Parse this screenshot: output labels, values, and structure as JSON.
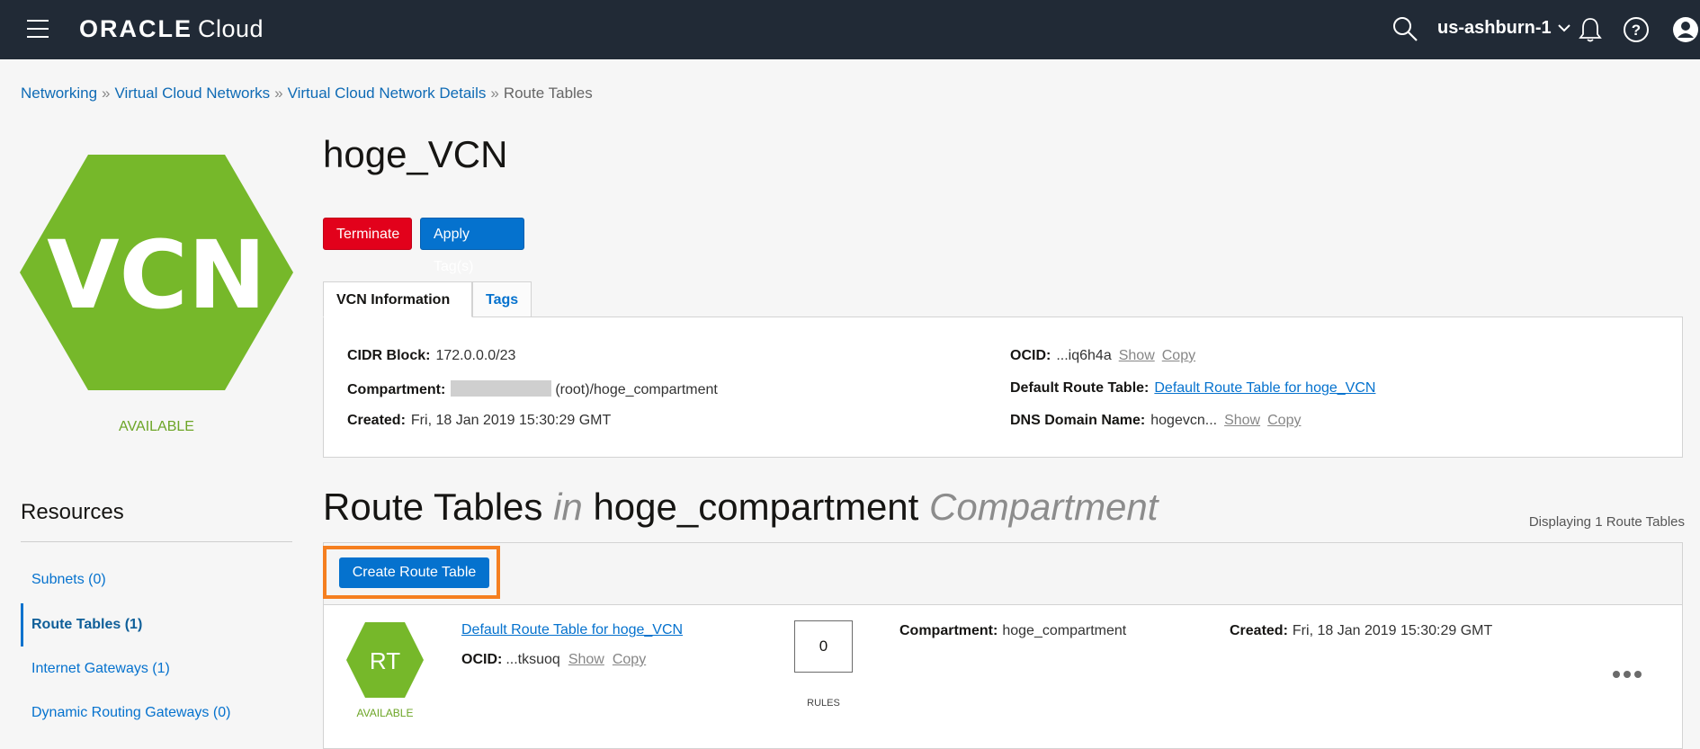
{
  "topbar": {
    "brand_oracle": "ORACLE",
    "brand_cloud": "Cloud",
    "region": "us-ashburn-1",
    "icons": [
      "menu-icon",
      "search-icon",
      "chevron-down-icon",
      "bell-icon",
      "help-icon",
      "user-icon"
    ]
  },
  "breadcrumb": {
    "items": [
      "Networking",
      "Virtual Cloud Networks",
      "Virtual Cloud Network Details"
    ],
    "current": "Route Tables",
    "separator": "»"
  },
  "vcn": {
    "badge": "VCN",
    "status": "AVAILABLE",
    "name": "hoge_VCN",
    "color": "#76b82a"
  },
  "actions": {
    "terminate": "Terminate",
    "apply_tags": "Apply Tag(s)"
  },
  "tabs": {
    "vcn_info": "VCN Information",
    "tags": "Tags"
  },
  "info": {
    "cidr_label": "CIDR Block:",
    "cidr_value": "172.0.0.0/23",
    "compartment_label": "Compartment:",
    "compartment_value": "(root)/hoge_compartment",
    "created_label": "Created:",
    "created_value": "Fri, 18 Jan 2019 15:30:29 GMT",
    "ocid_label": "OCID:",
    "ocid_value": "...iq6h4a",
    "show": "Show",
    "copy": "Copy",
    "default_rt_label": "Default Route Table:",
    "default_rt_value": "Default Route Table for hoge_VCN",
    "dns_label": "DNS Domain Name:",
    "dns_value": "hogevcn..."
  },
  "resources": {
    "title": "Resources",
    "items": [
      "Subnets (0)",
      "Route Tables (1)",
      "Internet Gateways (1)",
      "Dynamic Routing Gateways (0)"
    ],
    "active_index": 1
  },
  "route_tables": {
    "title_main": "Route Tables",
    "title_in": "in",
    "title_compartment": "hoge_compartment",
    "title_suffix": "Compartment",
    "displaying": "Displaying 1 Route Tables",
    "create_button": "Create Route Table",
    "rows": [
      {
        "badge": "RT",
        "status": "AVAILABLE",
        "name": "Default Route Table for hoge_VCN",
        "ocid_label": "OCID:",
        "ocid_value": "...tksuoq",
        "show": "Show",
        "copy": "Copy",
        "rules_count": "0",
        "rules_label": "RULES",
        "compartment_label": "Compartment:",
        "compartment_value": "hoge_compartment",
        "created_label": "Created:",
        "created_value": "Fri, 18 Jan 2019 15:30:29 GMT"
      }
    ]
  },
  "colors": {
    "topbar": "#212a36",
    "accent": "#0572ce",
    "danger": "#e2011b",
    "status_green": "#76b82a",
    "highlight": "#f57f20"
  }
}
